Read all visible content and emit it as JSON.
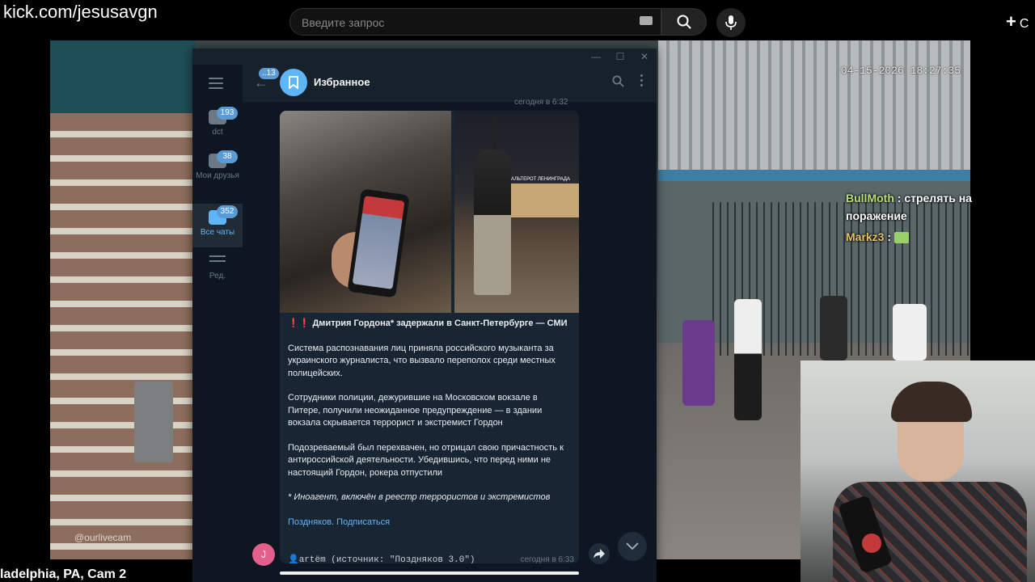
{
  "overlay": {
    "url": "kick.com/jesusavgn",
    "cam_caption": "ladelphia, PA, Cam 2",
    "cam_timestamp": "04-15-2026 18:27:35",
    "cam_watermark": "@ourlivecam"
  },
  "topbar": {
    "search_placeholder": "Введите запрос",
    "create_label": "+",
    "create_text": "С"
  },
  "stream_chat": [
    {
      "user": "BullMoth",
      "message": "стрелять на поражение"
    },
    {
      "user": "Markz3",
      "message": ""
    }
  ],
  "telegram": {
    "folders": [
      {
        "label": "dct",
        "badge": "193",
        "active": false
      },
      {
        "label": "Мои друзья",
        "badge": "38",
        "active": false
      },
      {
        "label": "Все чаты",
        "badge": "352",
        "active": true
      },
      {
        "label": "Ред.",
        "badge": "",
        "active": false
      }
    ],
    "header": {
      "back_badge": "13",
      "title": "Избранное"
    },
    "prev_time": "сегодня в 6:32",
    "message": {
      "photo_sign": "АЛЬТЕРОТ ЛЕНИНГРАДА",
      "headline_marks": "❗❗",
      "headline": "Дмитрия Гордона* задержали в Санкт-Петербурге — СМИ",
      "paragraph1": "Система распознавания лиц приняла российского музыканта за украинского журналиста, что вызвало переполох среди местных полицейских.",
      "paragraph2": "Сотрудники полиции, дежурившие на Московском вокзале в Питере, получили неожиданное предупреждение — в здании вокзала скрывается террорист и экстремист Гордон",
      "paragraph3": "Подозреваемый был перехвачен, но отрицал свою причастность к антироссийской деятельности. Убедившись, что перед ними не настоящий Гордон, рокера отпустили",
      "footnote": "* Иноагент, включён в реестр террористов и экстремистов",
      "link": "Поздняков. Подписаться",
      "signature": "👤artëm (источник: \"Поздняков 3.0\")",
      "time": "сегодня в 6:33",
      "sender_initial": "J"
    }
  },
  "colors": {
    "tg_bg": "#17212b",
    "tg_accent": "#5eb5f7",
    "bubble": "#182533",
    "link": "#6ab3f3"
  },
  "icons": [
    "search-icon",
    "mic-icon",
    "keyboard-icon",
    "menu-icon",
    "folder-icon",
    "edit-icon",
    "back-arrow-icon",
    "bookmark-icon",
    "more-icon",
    "share-icon",
    "chevron-down-icon"
  ]
}
